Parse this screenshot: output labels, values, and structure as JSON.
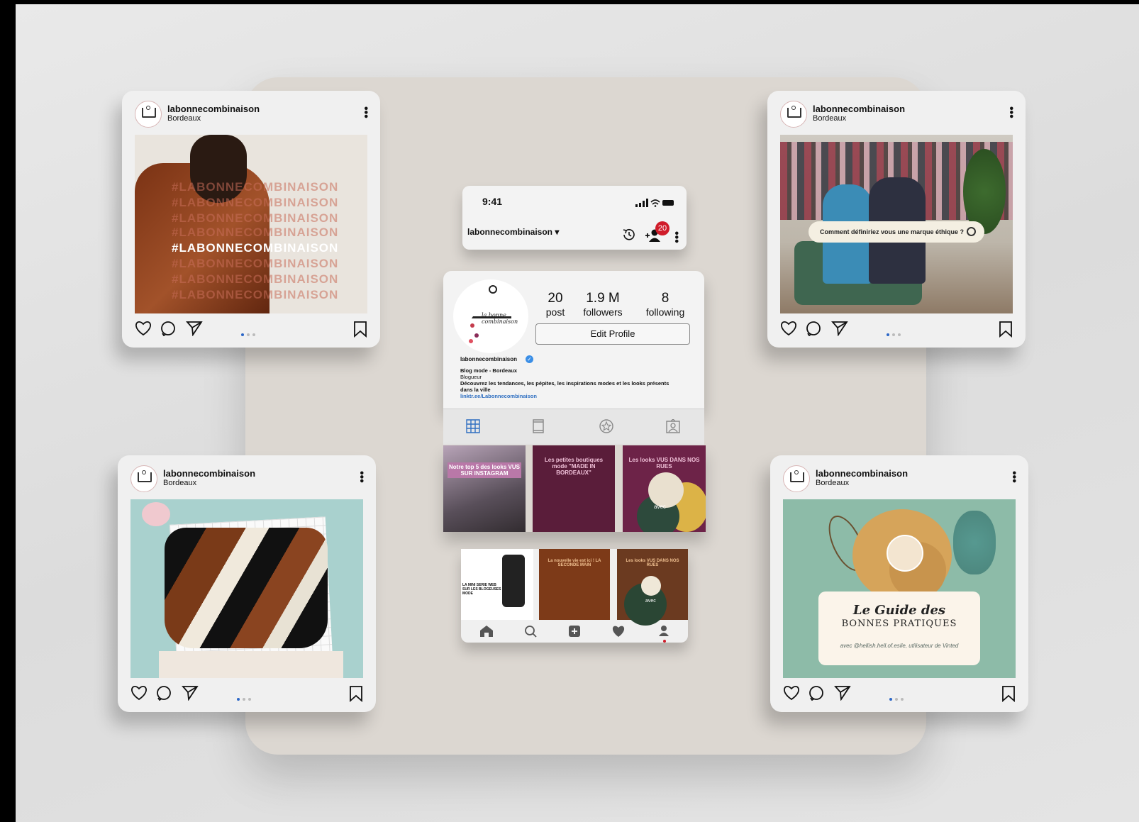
{
  "posts": [
    {
      "username": "labonnecombinaison",
      "location": "Bordeaux",
      "hashtag": "#LABONNECOMBINAISON"
    },
    {
      "username": "labonnecombinaison",
      "location": "Bordeaux",
      "search_prompt": "Comment définiriez vous une marque éthique ?"
    },
    {
      "username": "labonnecombinaison",
      "location": "Bordeaux"
    },
    {
      "username": "labonnecombinaison",
      "location": "Bordeaux",
      "guide_title": "Le Guide des",
      "guide_subtitle": "BONNES PRATIQUES",
      "guide_caption": "avec @hellish.hell.of.esile, utilisateur de Vinted"
    }
  ],
  "phone": {
    "time": "9:41",
    "account": "labonnecombinaison",
    "notification_count": "20"
  },
  "profile": {
    "logo_text": "la bonne combinaison",
    "posts_count": "20",
    "posts_label": "post",
    "followers_count": "1.9 M",
    "followers_label": "followers",
    "following_count": "8",
    "following_label": "following",
    "edit_profile": "Edit Profile",
    "username": "labonnecombinaison",
    "bio_title": "Blog mode - Bordeaux",
    "bio_category": "Blogueur",
    "bio_text": "Découvrez les tendances, les pépites, les inspirations modes et les looks présents dans la ville",
    "bio_link": "linktr.ee/Labonnecombinaison"
  },
  "grid": [
    {
      "title": "Notre top 5 des looks VUS SUR INSTAGRAM"
    },
    {
      "title": "Les petites boutiques mode \"MADE IN BORDEAUX\""
    },
    {
      "title": "Les looks VUS DANS NOS RUES",
      "avec": "avec"
    },
    {
      "title": "LA MINI SERIE WEB SUR LES BLOGEUSES MODE"
    },
    {
      "title": "La nouvelle vie est ici ! LA SECONDE MAIN"
    },
    {
      "title": "Les looks VUS DANS NOS RUES",
      "avec": "avec"
    }
  ],
  "colors": {
    "badge": "#d01c2a",
    "link": "#2f6fc1",
    "verified": "#3a8ee6",
    "pager_active": "#2c67c7"
  }
}
